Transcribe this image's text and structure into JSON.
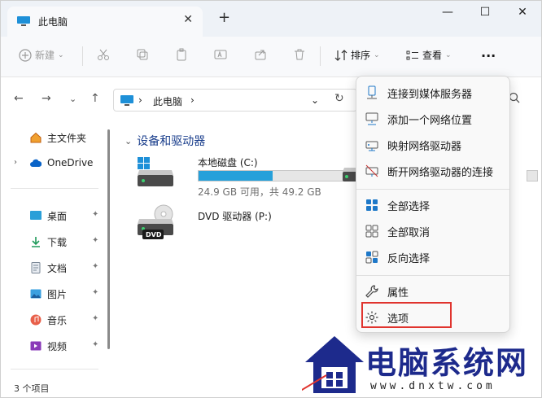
{
  "window": {
    "tab_title": "此电脑",
    "close_tab": "✕",
    "new_tab": "+",
    "minimize": "—",
    "maximize": "☐",
    "close": "✕"
  },
  "toolbar": {
    "new_label": "新建",
    "sort_label": "排序",
    "view_label": "查看",
    "more_label": "···"
  },
  "address": {
    "crumb_sep": "›",
    "location": "此电脑",
    "crumb_end": "›",
    "dropdown": "⌄",
    "refresh": "↻"
  },
  "nav": {
    "back": "←",
    "forward": "→",
    "recent": "⌄",
    "up": "↑"
  },
  "sidebar": {
    "home": "主文件夹",
    "onedrive": "OneDrive",
    "expand": "›",
    "pin": "📌",
    "items": [
      {
        "label": "桌面"
      },
      {
        "label": "下载"
      },
      {
        "label": "文档"
      },
      {
        "label": "图片"
      },
      {
        "label": "音乐"
      },
      {
        "label": "视频"
      }
    ]
  },
  "content": {
    "group_title": "设备和驱动器",
    "group_chevron": "⌄",
    "drives": [
      {
        "name": "本地磁盘 (C:)",
        "info": "24.9 GB 可用，共 49.2 GB",
        "used_fraction": 0.49
      },
      {
        "name": "DVD 驱动器 (P:)",
        "badge": "DVD"
      }
    ]
  },
  "status": {
    "items_text": "3 个项目"
  },
  "menu": {
    "items": [
      {
        "label": "连接到媒体服务器"
      },
      {
        "label": "添加一个网络位置"
      },
      {
        "label": "映射网络驱动器"
      },
      {
        "label": "断开网络驱动器的连接"
      },
      {
        "label": "全部选择"
      },
      {
        "label": "全部取消"
      },
      {
        "label": "反向选择"
      },
      {
        "label": "属性"
      },
      {
        "label": "选项"
      }
    ]
  },
  "watermark": {
    "text": "电脑系统网",
    "url": "www.dnxtw.com"
  },
  "colors": {
    "accent": "#26a0da",
    "highlight": "#e0342e",
    "watermark": "#1d2a8c"
  }
}
